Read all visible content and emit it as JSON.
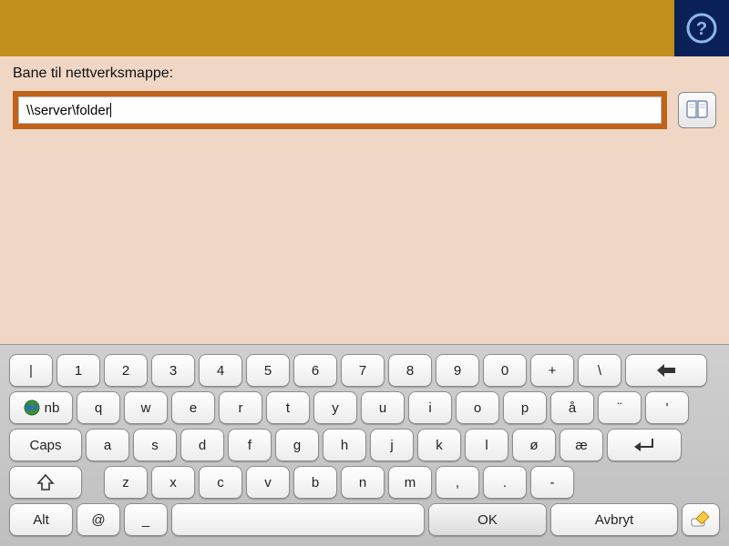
{
  "header": {
    "help_aria": "Help"
  },
  "field": {
    "label": "Bane til nettverksmappe:",
    "value": "\\\\server\\folder"
  },
  "addressbook": {
    "aria": "Address book"
  },
  "keyboard": {
    "row1": [
      "|",
      "1",
      "2",
      "3",
      "4",
      "5",
      "6",
      "7",
      "8",
      "9",
      "0",
      "+",
      "\\"
    ],
    "row2_lang": "nb",
    "row2": [
      "q",
      "w",
      "e",
      "r",
      "t",
      "y",
      "u",
      "i",
      "o",
      "p",
      "å",
      "¨",
      "'"
    ],
    "caps": "Caps",
    "row3": [
      "a",
      "s",
      "d",
      "f",
      "g",
      "h",
      "j",
      "k",
      "l",
      "ø",
      "æ"
    ],
    "row4": [
      "z",
      "x",
      "c",
      "v",
      "b",
      "n",
      "m",
      ",",
      ".",
      "-"
    ],
    "alt": "Alt",
    "at": "@",
    "underscore": "_",
    "ok": "OK",
    "cancel": "Avbryt"
  }
}
